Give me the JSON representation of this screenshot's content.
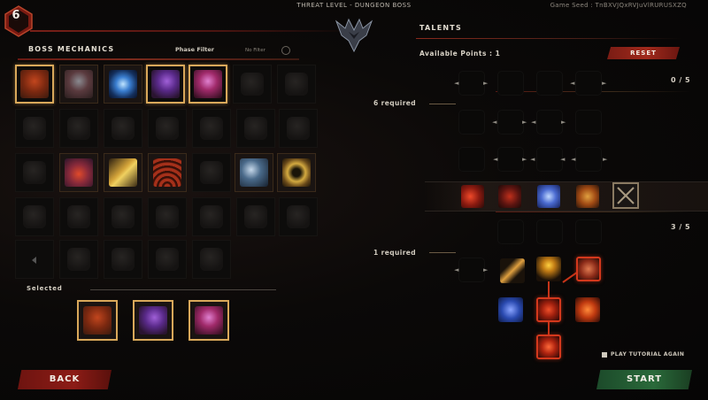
{
  "header": {
    "level": "6",
    "title": "THREAT LEVEL - DUNGEON BOSS",
    "seed": "Game Seed : TnBXVJQxRVJuVlRURUSXZQ"
  },
  "boss_mechanics": {
    "title": "BOSS MECHANICS",
    "phase_filter_label": "Phase Filter",
    "phase_filter_value": "No Filter",
    "selected_label": "Selected"
  },
  "talents": {
    "title": "TALENTS",
    "available_points": "Available Points : 1",
    "reset_label": "RESET",
    "tier1": {
      "required": "6 required",
      "count": "0 / 5"
    },
    "tier2": {
      "required": "1 required",
      "count": "3 / 5"
    },
    "tutorial_label": "PLAY TUTORIAL AGAIN"
  },
  "buttons": {
    "back": "BACK",
    "start": "START"
  },
  "colors": {
    "selection_border": "#d9a85a",
    "back_button": "#8c1c16",
    "start_button": "#2a6a3a",
    "talent_highlight": "#d4381c"
  }
}
